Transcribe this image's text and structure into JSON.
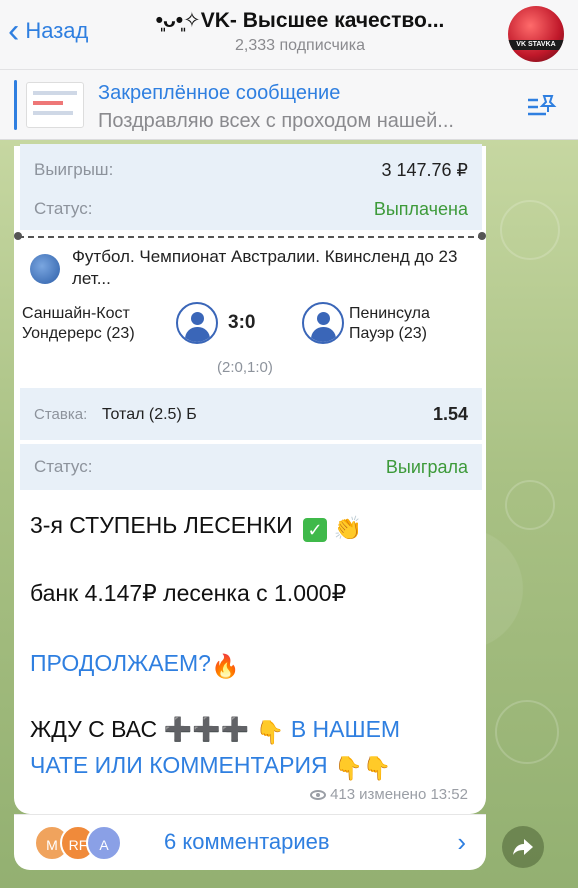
{
  "header": {
    "back_label": "Назад",
    "title": "•͈ᴗ•͈✧VK- Высшее качество...",
    "subtitle": "2,333 подписчика",
    "avatar_text": "VK STAVKA"
  },
  "pinned": {
    "title": "Закреплённое сообщение",
    "text": "Поздравляю всех с проходом нашей..."
  },
  "ticket": {
    "win_label": "Выигрыш:",
    "win_value": "3 147.76 ₽",
    "status_label_1": "Статус:",
    "status_value_1": "Выплачена",
    "league": "Футбол. Чемпионат Австралии. Квинсленд до 23 лет...",
    "team_left": "Саншайн-Кост Уондерерс (23)",
    "team_right": "Пенинсула Пауэр (23)",
    "score": "3:0",
    "halves": "(2:0,1:0)",
    "bet_label": "Ставка:",
    "bet_market": "Тотал (2.5) Б",
    "bet_odds": "1.54",
    "status_label_2": "Статус:",
    "status_value_2": "Выиграла"
  },
  "message": {
    "line1": "3-я СТУПЕНЬ ЛЕСЕНКИ",
    "line2": "банк 4.147₽ лесенка с 1.000₽",
    "line3": "ПРОДОЛЖАЕМ?",
    "line4": "ЖДУ С ВАС ➕➕➕",
    "line4b": "В НАШЕМ",
    "line5": "ЧАТЕ ИЛИ КОММЕНТАРИЯ",
    "views": "413",
    "edited": "изменено 13:52"
  },
  "comments": {
    "avatars": [
      "M",
      "RF",
      "A"
    ],
    "label": "6 комментариев"
  }
}
